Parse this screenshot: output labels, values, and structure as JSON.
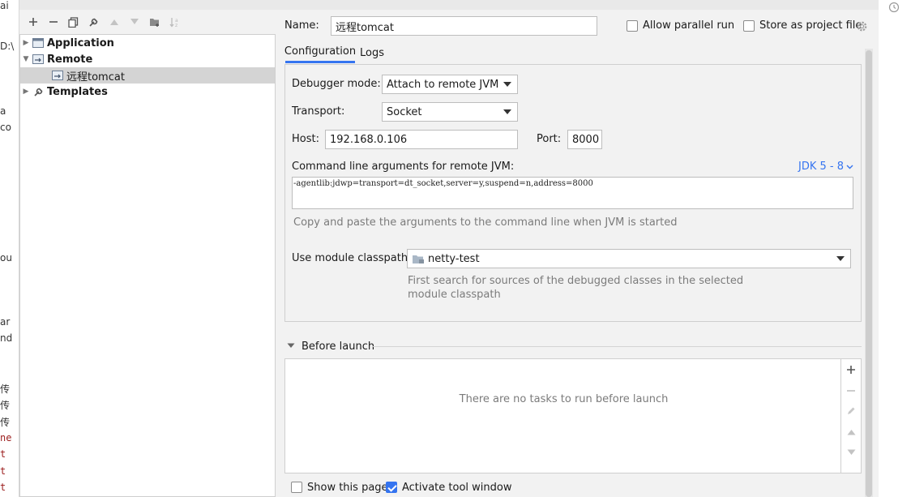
{
  "background": {
    "left_fragments": [
      "ai",
      "D:\\",
      "a",
      "co",
      "ou",
      "ar",
      "nd",
      "传",
      "传",
      "传",
      "ne",
      "t",
      "t",
      "t"
    ]
  },
  "toolbar": {
    "icons": [
      "add-icon",
      "remove-icon",
      "copy-icon",
      "wrench-icon",
      "move-up-icon",
      "move-down-icon",
      "new-folder-icon",
      "sort-icon"
    ]
  },
  "tree": {
    "items": [
      {
        "label": "Application",
        "expanded": false,
        "bold": true
      },
      {
        "label": "Remote",
        "expanded": true,
        "bold": true
      },
      {
        "label": "远程tomcat",
        "selected": true
      },
      {
        "label": "Templates",
        "expanded": false,
        "bold": true
      }
    ]
  },
  "form": {
    "name_label": "Name:",
    "name_value": "远程tomcat",
    "allow_parallel_label": "Allow parallel run",
    "allow_parallel_checked": false,
    "store_project_label": "Store as project file",
    "store_project_checked": false,
    "tabs": [
      {
        "label": "Configuration",
        "active": true
      },
      {
        "label": "Logs",
        "active": false
      }
    ],
    "debugger_mode_label": "Debugger mode:",
    "debugger_mode_value": "Attach to remote JVM",
    "transport_label": "Transport:",
    "transport_value": "Socket",
    "host_label": "Host:",
    "host_value": "192.168.0.106",
    "port_label": "Port:",
    "port_value": "8000",
    "cmd_label": "Command line arguments for remote JVM:",
    "jdk_selector": "JDK 5 - 8",
    "cmd_value": "-agentlib:jdwp=transport=dt_socket,server=y,suspend=n,address=8000",
    "cmd_hint": "Copy and paste the arguments to the command line when JVM is started",
    "module_label": "Use module classpath:",
    "module_value": "netty-test",
    "module_hint_line1": "First search for sources of the debugged classes in the selected",
    "module_hint_line2": "module classpath",
    "before_launch_label": "Before launch",
    "no_tasks_text": "There are no tasks to run before launch",
    "show_page_label": "Show this page",
    "show_page_checked": false,
    "activate_tool_label": "Activate tool window",
    "activate_tool_checked": true
  },
  "colors": {
    "link": "#3574f0",
    "checkbox_checked": "#3574f0",
    "selection": "#d4d4d4"
  }
}
